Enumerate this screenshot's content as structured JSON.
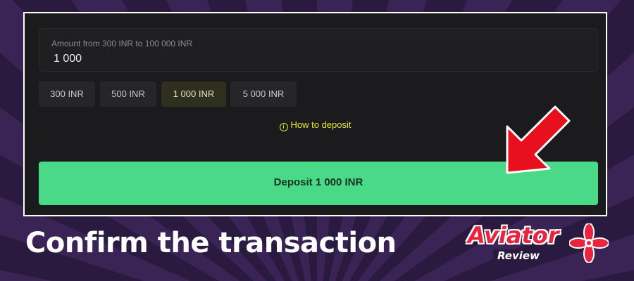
{
  "form": {
    "amount_label": "Amount from 300 INR to 100 000 INR",
    "amount_value": "1 000",
    "presets": [
      {
        "label": "300 INR",
        "selected": false
      },
      {
        "label": "500 INR",
        "selected": false
      },
      {
        "label": "1 000 INR",
        "selected": true
      },
      {
        "label": "5 000 INR",
        "selected": false
      }
    ],
    "how_to_label": "How to deposit",
    "deposit_label": "Deposit 1 000 INR"
  },
  "caption": "Confirm the transaction",
  "logo": {
    "word": "Aviator",
    "sub": "Review"
  },
  "colors": {
    "accent_green": "#4ad986",
    "link_yellow": "#e9e631",
    "arrow_red": "#e8101c",
    "brand_red": "#e8243e"
  },
  "icons": {
    "info": "info-circle-icon",
    "arrow": "red-arrow-icon",
    "propeller": "propeller-icon"
  }
}
